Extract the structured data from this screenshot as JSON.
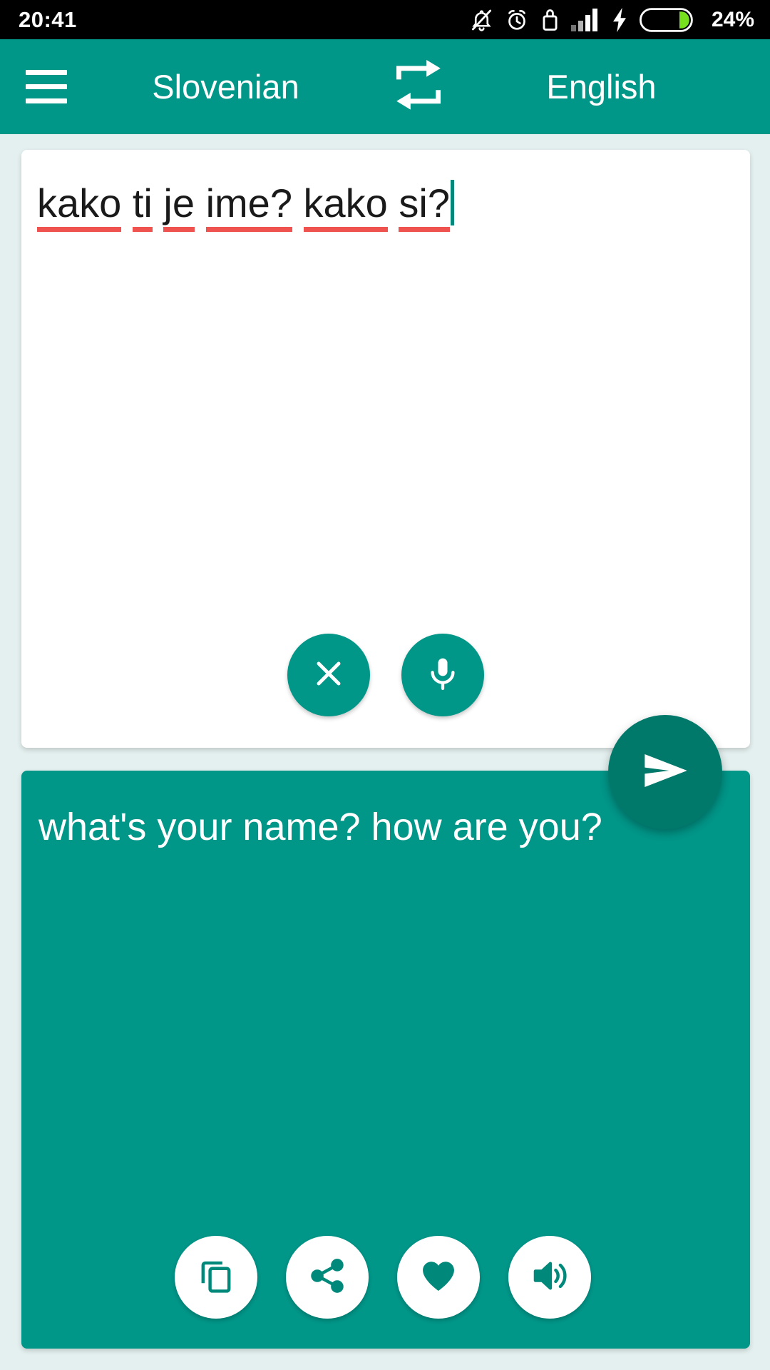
{
  "status_bar": {
    "time": "20:41",
    "battery_percent": "24%",
    "icons": [
      "notifications-off-icon",
      "alarm-icon",
      "usb-lock-icon",
      "signal-bars-icon",
      "charging-bolt-icon",
      "battery-icon"
    ],
    "battery_fill_color": "#76e01f",
    "background_color": "#000000"
  },
  "app_bar": {
    "menu_label": "menu",
    "source_language": "Slovenian",
    "swap_label": "swap-languages",
    "target_language": "English",
    "background_color": "#009688"
  },
  "input_card": {
    "text": "kako ti je ime? kako si?",
    "words": [
      "kako",
      "ti",
      "je",
      "ime?",
      "kako",
      "si?"
    ],
    "spellcheck_underline_color": "#ef5350",
    "caret_color": "#00897b",
    "background_color": "#ffffff",
    "actions": [
      {
        "name": "clear-button",
        "icon": "close-icon",
        "label": "Clear"
      },
      {
        "name": "voice-input-button",
        "icon": "microphone-icon",
        "label": "Voice input"
      }
    ]
  },
  "send_button": {
    "name": "translate-send-button",
    "icon": "send-icon",
    "label": "Translate",
    "color": "#00796b"
  },
  "output_card": {
    "text": "what's your name? how are you?",
    "background_color": "#009688",
    "text_color": "#ffffff",
    "actions": [
      {
        "name": "copy-button",
        "icon": "copy-icon",
        "label": "Copy"
      },
      {
        "name": "share-button",
        "icon": "share-icon",
        "label": "Share"
      },
      {
        "name": "favorite-button",
        "icon": "heart-icon",
        "label": "Favorite"
      },
      {
        "name": "speak-button",
        "icon": "speaker-icon",
        "label": "Listen"
      }
    ]
  },
  "page": {
    "background_color": "#e4f0ef"
  }
}
